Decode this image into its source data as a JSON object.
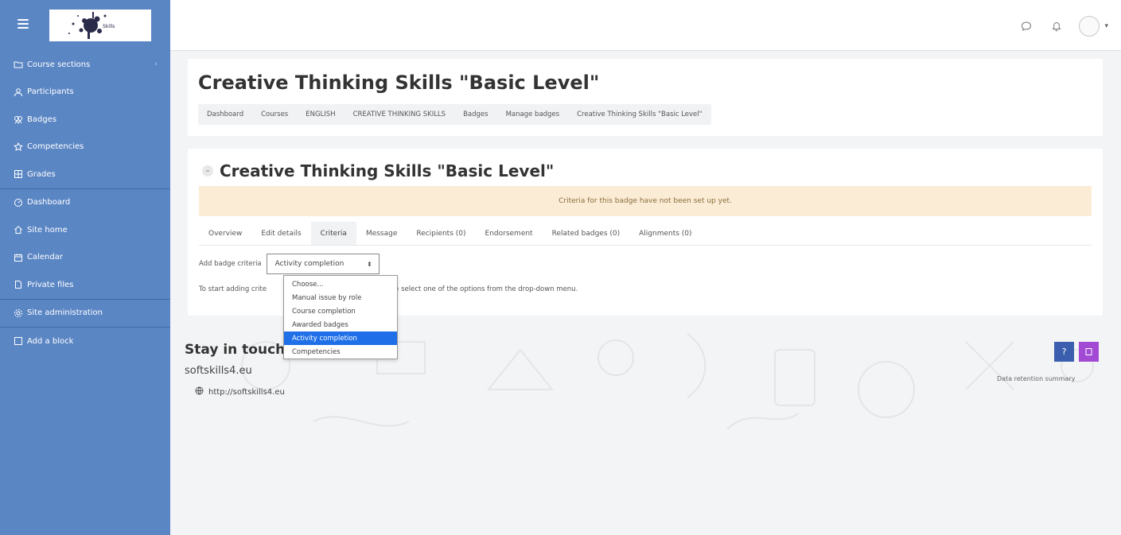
{
  "colors": {
    "sidebar": "#5b86c4",
    "alert_bg": "#fbecd6",
    "dropdown_selected": "#1e6fe8",
    "help_button": "#3b5fae",
    "purple_button": "#a24ad4"
  },
  "navbar": {
    "icons": [
      "hamburger-icon",
      "chat-icon",
      "bell-icon",
      "user-avatar"
    ]
  },
  "sidebar": {
    "items": [
      {
        "label": "Course sections",
        "icon": "folder-icon"
      },
      {
        "label": "Participants",
        "icon": "users-icon"
      },
      {
        "label": "Badges",
        "icon": "badge-icon"
      },
      {
        "label": "Competencies",
        "icon": "competency-icon"
      },
      {
        "label": "Grades",
        "icon": "grades-icon"
      },
      {
        "label": "Dashboard",
        "icon": "dashboard-icon"
      },
      {
        "label": "Site home",
        "icon": "home-icon"
      },
      {
        "label": "Calendar",
        "icon": "calendar-icon"
      },
      {
        "label": "Private files",
        "icon": "file-icon"
      },
      {
        "label": "Site administration",
        "icon": "gear-icon"
      },
      {
        "label": "Add a block",
        "icon": "plus-square-icon"
      }
    ]
  },
  "header": {
    "title": "Creative Thinking Skills \"Basic Level\"",
    "breadcrumb": [
      "Dashboard",
      "Courses",
      "ENGLISH",
      "CREATIVE THINKING SKILLS",
      "Badges",
      "Manage badges",
      "Creative Thinking Skills \"Basic Level\""
    ]
  },
  "main": {
    "title": "Creative Thinking Skills \"Basic Level\"",
    "alert": "Criteria for this badge have not been set up yet.",
    "tabs": [
      "Overview",
      "Edit details",
      "Criteria",
      "Message",
      "Recipients (0)",
      "Endorsement",
      "Related badges (0)",
      "Alignments (0)"
    ],
    "active_tab": "Criteria",
    "criteria_label": "Add badge criteria",
    "select_value": "Activity completion",
    "help_text_before": "To start adding crite",
    "help_text_after": "ria, please select one of the options from the drop-down menu.",
    "dropdown_options": [
      "Choose...",
      "Manual issue by role",
      "Course completion",
      "Awarded badges",
      "Activity completion",
      "Competencies"
    ],
    "dropdown_selected": "Activity completion"
  },
  "footer": {
    "title": "Stay in touch",
    "site": "softskills4.eu",
    "link": "http://softskills4.eu",
    "help_button_label": "?",
    "data_retention": "Data retention summary"
  }
}
